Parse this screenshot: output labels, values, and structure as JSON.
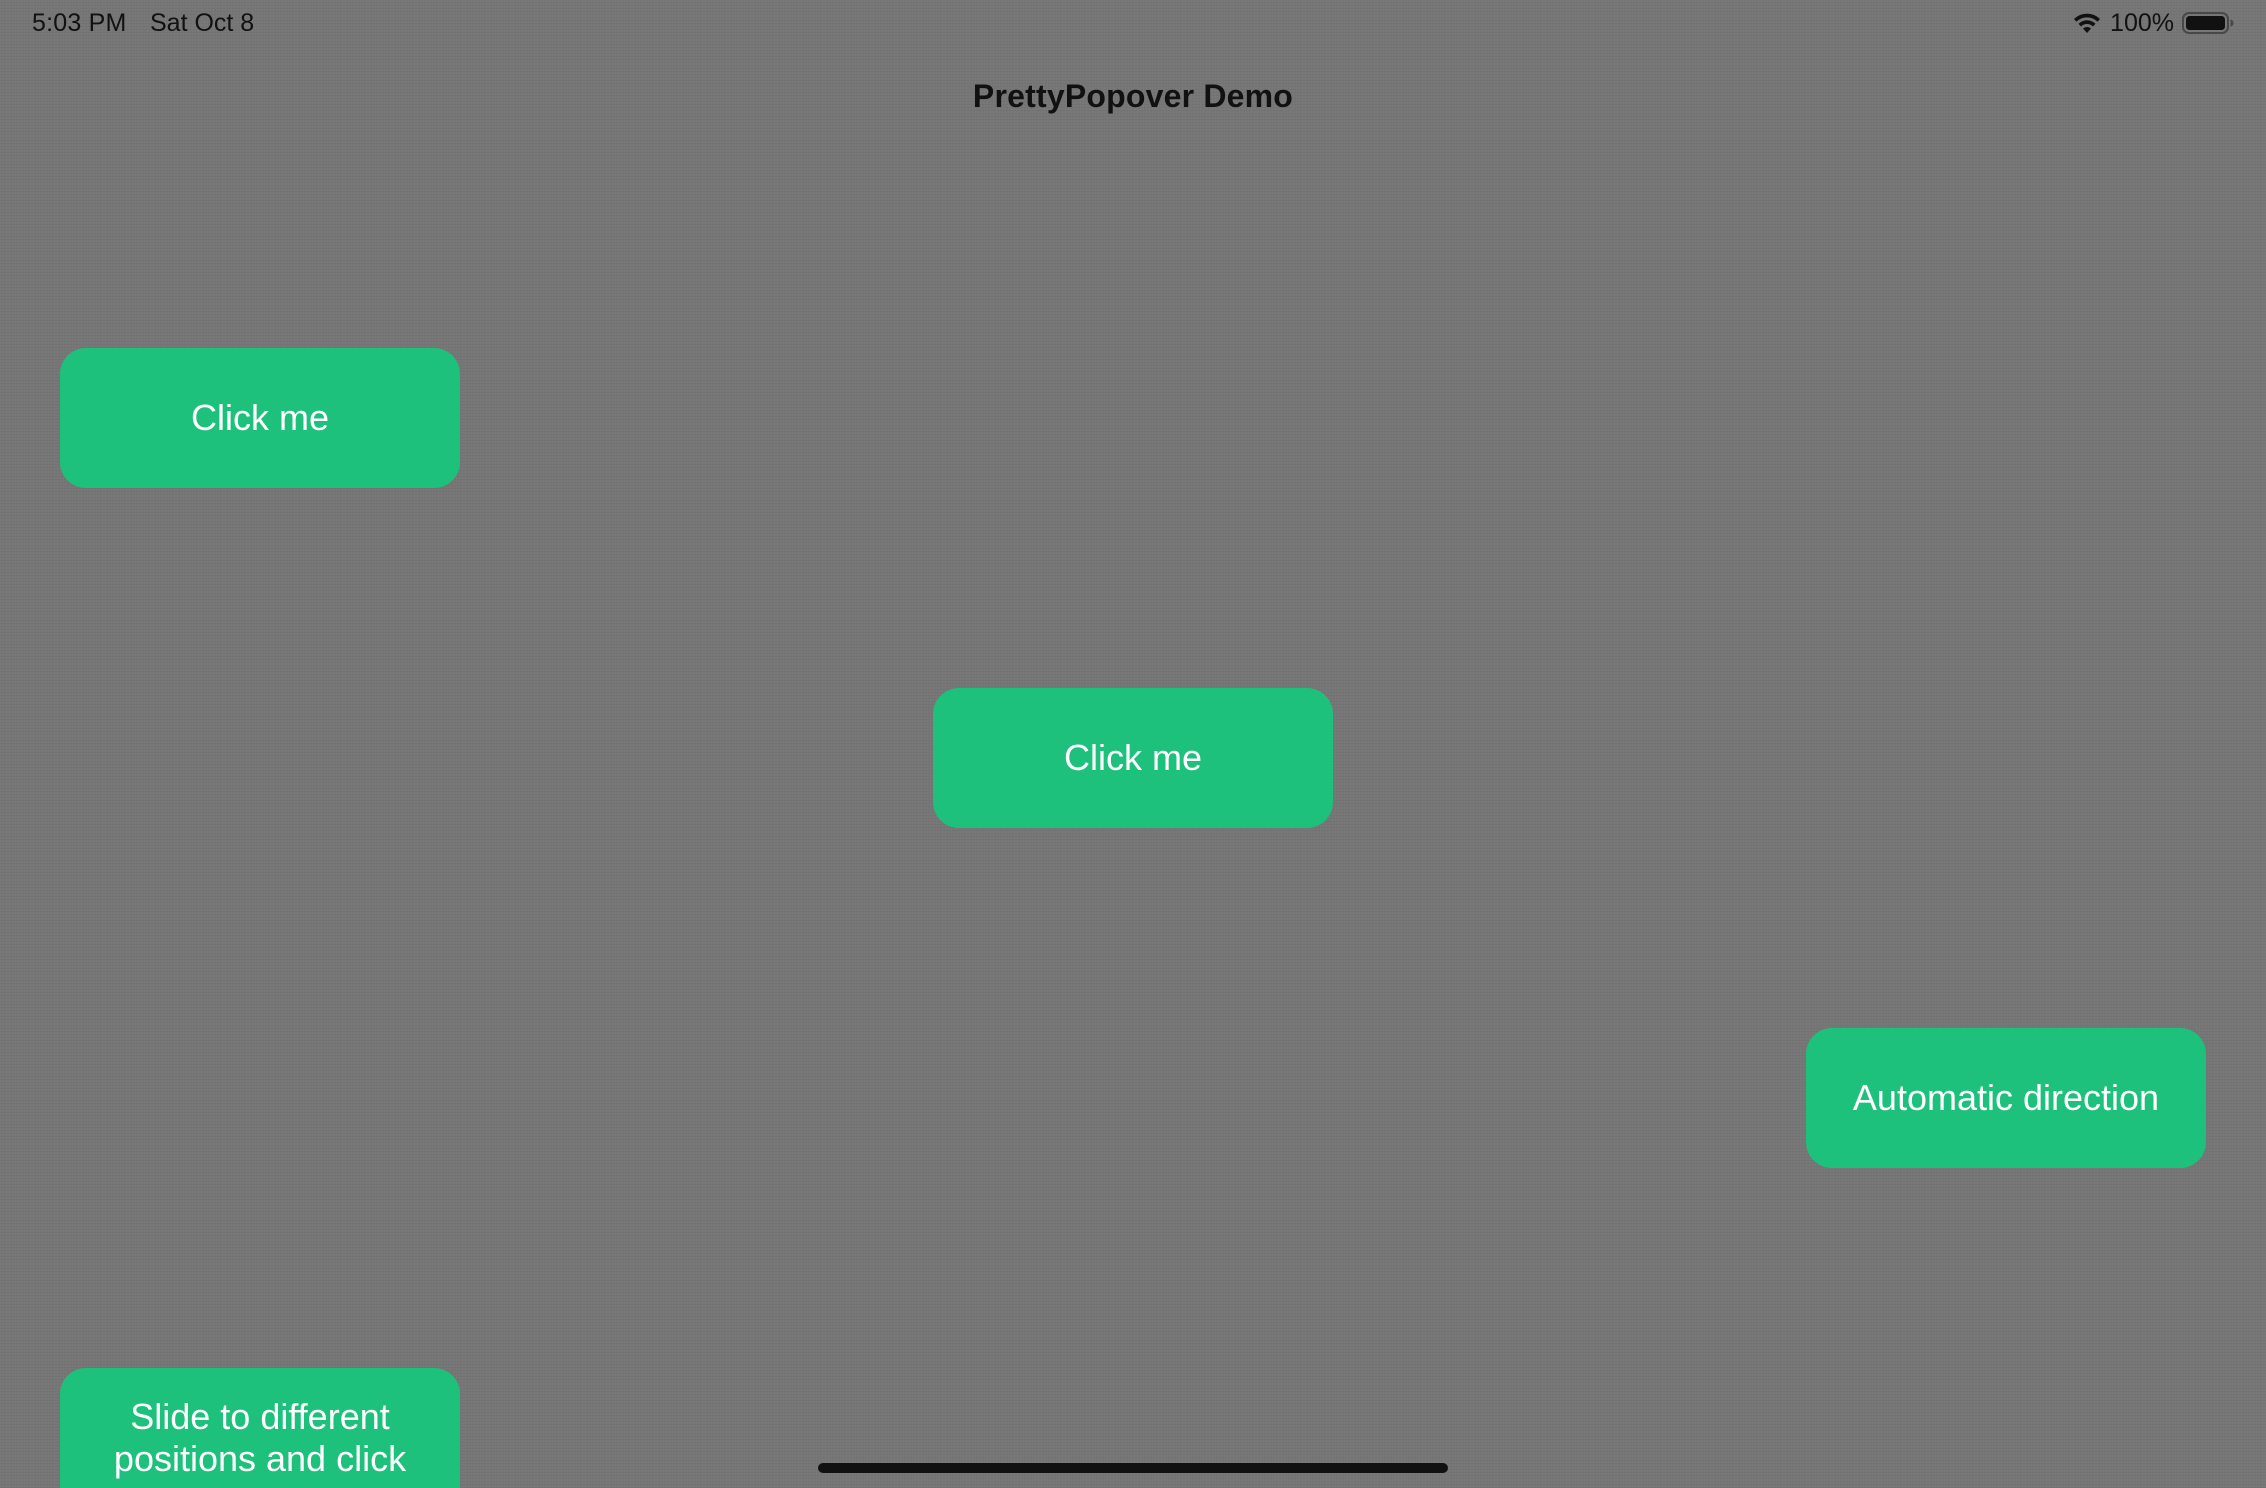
{
  "status_bar": {
    "time": "5:03 PM",
    "date": "Sat Oct 8",
    "battery_percent": "100%",
    "wifi_icon": "wifi-icon",
    "battery_icon": "battery-full-icon"
  },
  "nav": {
    "title": "PrettyPopover Demo"
  },
  "buttons": {
    "top_left": "Click me",
    "center": "Click me",
    "right": "Automatic direction",
    "bottom_left": "Slide to different positions and click"
  },
  "colors": {
    "background": "#767676",
    "button": "#1ec17c",
    "button_text": "#ffffff"
  }
}
